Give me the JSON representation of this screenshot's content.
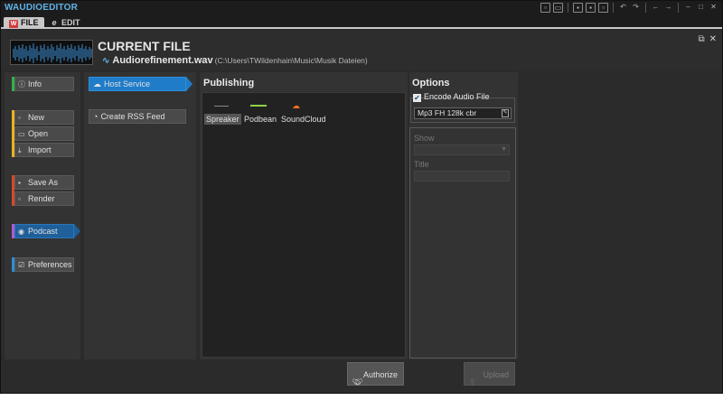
{
  "app": {
    "title": "AUDIOEDITOR"
  },
  "tabs": [
    {
      "label": "FILE",
      "icon": "w-logo-icon"
    },
    {
      "label": "EDIT",
      "icon": "edit-icon"
    }
  ],
  "header": {
    "title": "CURRENT FILE",
    "filename": "Audiorefinement.wav",
    "path": "(C:\\Users\\TWildenhain\\Music\\Musik Dateien)"
  },
  "nav": {
    "info": "Info",
    "new": "New",
    "open": "Open",
    "import": "Import",
    "save_as": "Save As",
    "render": "Render",
    "podcast": "Podcast",
    "preferences": "Preferences"
  },
  "podcast_menu": {
    "host_service": "Host Service",
    "create_rss": "Create RSS Feed"
  },
  "publishing": {
    "title": "Publishing",
    "services": [
      "Spreaker",
      "Podbean",
      "SoundCloud"
    ],
    "selected": "Spreaker"
  },
  "options": {
    "title": "Options",
    "encode_label": "Encode Audio File",
    "encode_checked": true,
    "format": "Mp3 FH 128k cbr",
    "show_label": "Show",
    "title_label": "Title"
  },
  "buttons": {
    "authorize": "Authorize",
    "upload": "Upload"
  },
  "colors": {
    "accent": "#1f7cc9",
    "group_info": "#2fb34a",
    "group_file": "#e8b31e",
    "group_save": "#d9472c",
    "group_podcast": "#b05ad0",
    "group_prefs": "#2a8fd8"
  }
}
